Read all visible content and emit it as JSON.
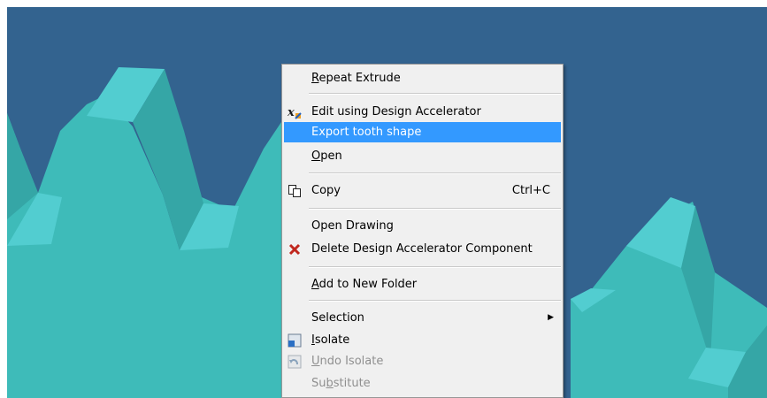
{
  "menu": {
    "items": [
      {
        "label": "Repeat Extrude",
        "u": 0
      },
      {
        "label": "Edit using Design Accelerator",
        "icon": "design-accelerator-icon"
      },
      {
        "label": "Export tooth shape",
        "highlighted": true
      },
      {
        "label": "Open",
        "u": 0
      },
      {
        "label": "Copy",
        "shortcut": "Ctrl+C",
        "icon": "copy-icon"
      },
      {
        "label": "Open Drawing"
      },
      {
        "label": "Delete Design Accelerator Component",
        "icon": "delete-x-icon"
      },
      {
        "label": "Add to New Folder",
        "u": 0
      },
      {
        "label": "Selection",
        "submenu": true,
        "arrow": "▶"
      },
      {
        "label": "Isolate",
        "u": 0,
        "icon": "isolate-icon"
      },
      {
        "label": "Undo Isolate",
        "u": 0,
        "disabled": true,
        "icon": "undo-isolate-icon"
      },
      {
        "label": "Substitute",
        "u": 2,
        "disabled": true
      }
    ]
  },
  "colors": {
    "background": "#33638f",
    "gear_face": "#3ebbb9",
    "gear_light": "#52cdd0",
    "gear_dark": "#35a6a6",
    "menu_bg": "#f0f0f0",
    "highlight": "#3399ff"
  }
}
